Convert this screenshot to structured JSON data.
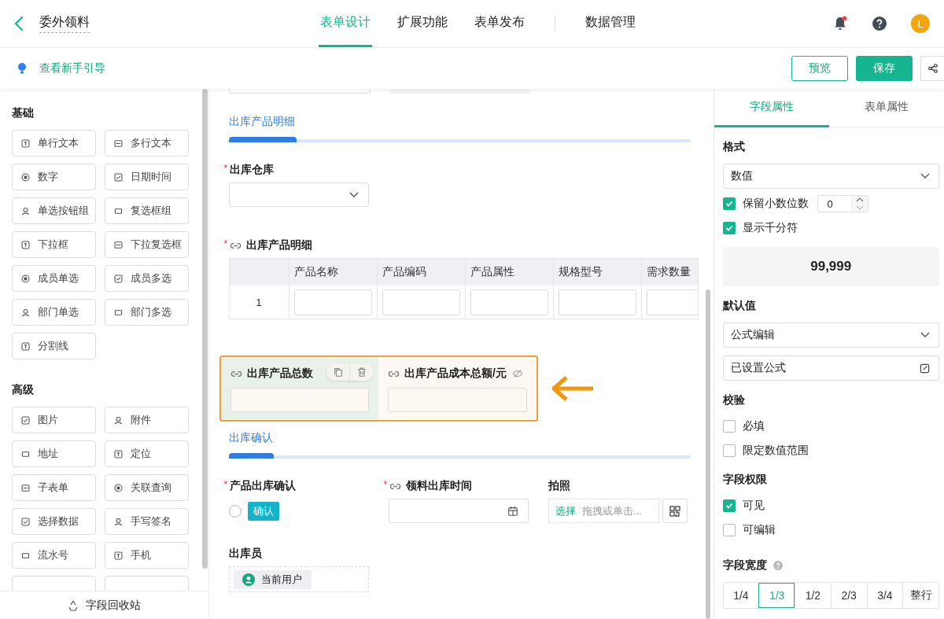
{
  "header": {
    "title": "委外领料",
    "tabs": [
      {
        "label": "表单设计",
        "selected": true
      },
      {
        "label": "扩展功能",
        "selected": false
      },
      {
        "label": "表单发布",
        "selected": false
      },
      {
        "label": "数据管理",
        "selected": false
      }
    ],
    "has_notification": true,
    "avatar": "L"
  },
  "toolbar": {
    "guide_link": "查看新手引导",
    "buttons": [
      {
        "label": "预览",
        "kind": "outline"
      },
      {
        "label": "保存",
        "kind": "primary"
      }
    ]
  },
  "palette": {
    "groups": [
      {
        "title": "基础",
        "items": [
          "单行文本",
          "多行文本",
          "数字",
          "日期时间",
          "单选按钮组",
          "复选框组",
          "下拉框",
          "下拉复选框",
          "成员单选",
          "成员多选",
          "部门单选",
          "部门多选",
          "分割线"
        ]
      },
      {
        "title": "高级",
        "items": [
          "图片",
          "附件",
          "地址",
          "定位",
          "子表单",
          "关联查询",
          "选择数据",
          "手写签名",
          "流水号",
          "手机"
        ]
      }
    ],
    "recycle_bin": "字段回收站"
  },
  "canvas": {
    "section_1": {
      "title": "出库产品明细"
    },
    "warehouse": {
      "label": "出库仓库",
      "required_mark": "*"
    },
    "subtable": {
      "label": "出库产品明细",
      "required_mark": "*",
      "linked": true,
      "columns": [
        "产品名称",
        "产品编码",
        "产品属性",
        "规格型号",
        "需求数量"
      ],
      "rows": [
        "1"
      ]
    },
    "selected_group": {
      "fields": [
        {
          "label": "出库产品总数",
          "linked": true,
          "selected": true,
          "hidden": false
        },
        {
          "label": "出库产品成本总额/元",
          "linked": true,
          "selected": false,
          "hidden": true
        }
      ]
    },
    "section_2": {
      "title": "出库确认"
    },
    "confirm": {
      "label": "产品出库确认",
      "required_mark": "*",
      "option": "确认",
      "checked": false
    },
    "time": {
      "label": "领料出库时间",
      "required_mark": "*",
      "linked": true
    },
    "photo": {
      "label": "拍照",
      "action": "选择",
      "placeholder": "拖拽或单击..."
    },
    "operator": {
      "label": "出库员",
      "value": "当前用户"
    }
  },
  "props": {
    "tabs": [
      {
        "label": "字段属性",
        "selected": true
      },
      {
        "label": "表单属性",
        "selected": false
      }
    ],
    "format": {
      "title": "格式",
      "value": "数值"
    },
    "options": [
      {
        "label": "保留小数位数",
        "checked": true,
        "kind": "stepper",
        "value": "0"
      },
      {
        "label": "显示千分符",
        "checked": true,
        "kind": "plain"
      }
    ],
    "preview": "99,999",
    "default": {
      "title": "默认值",
      "mode": "公式编辑",
      "formula": "已设置公式"
    },
    "validation": {
      "title": "校验",
      "items": [
        {
          "label": "必填",
          "checked": false
        },
        {
          "label": "限定数值范围",
          "checked": false
        }
      ]
    },
    "permission": {
      "title": "字段权限",
      "items": [
        {
          "label": "可见",
          "checked": true
        },
        {
          "label": "可编辑",
          "checked": false
        }
      ]
    },
    "width": {
      "title": "字段宽度",
      "options": [
        {
          "label": "1/4",
          "selected": false
        },
        {
          "label": "1/3",
          "selected": true
        },
        {
          "label": "1/2",
          "selected": false
        },
        {
          "label": "2/3",
          "selected": false
        },
        {
          "label": "3/4",
          "selected": false
        },
        {
          "label": "整行",
          "selected": false
        }
      ]
    }
  }
}
